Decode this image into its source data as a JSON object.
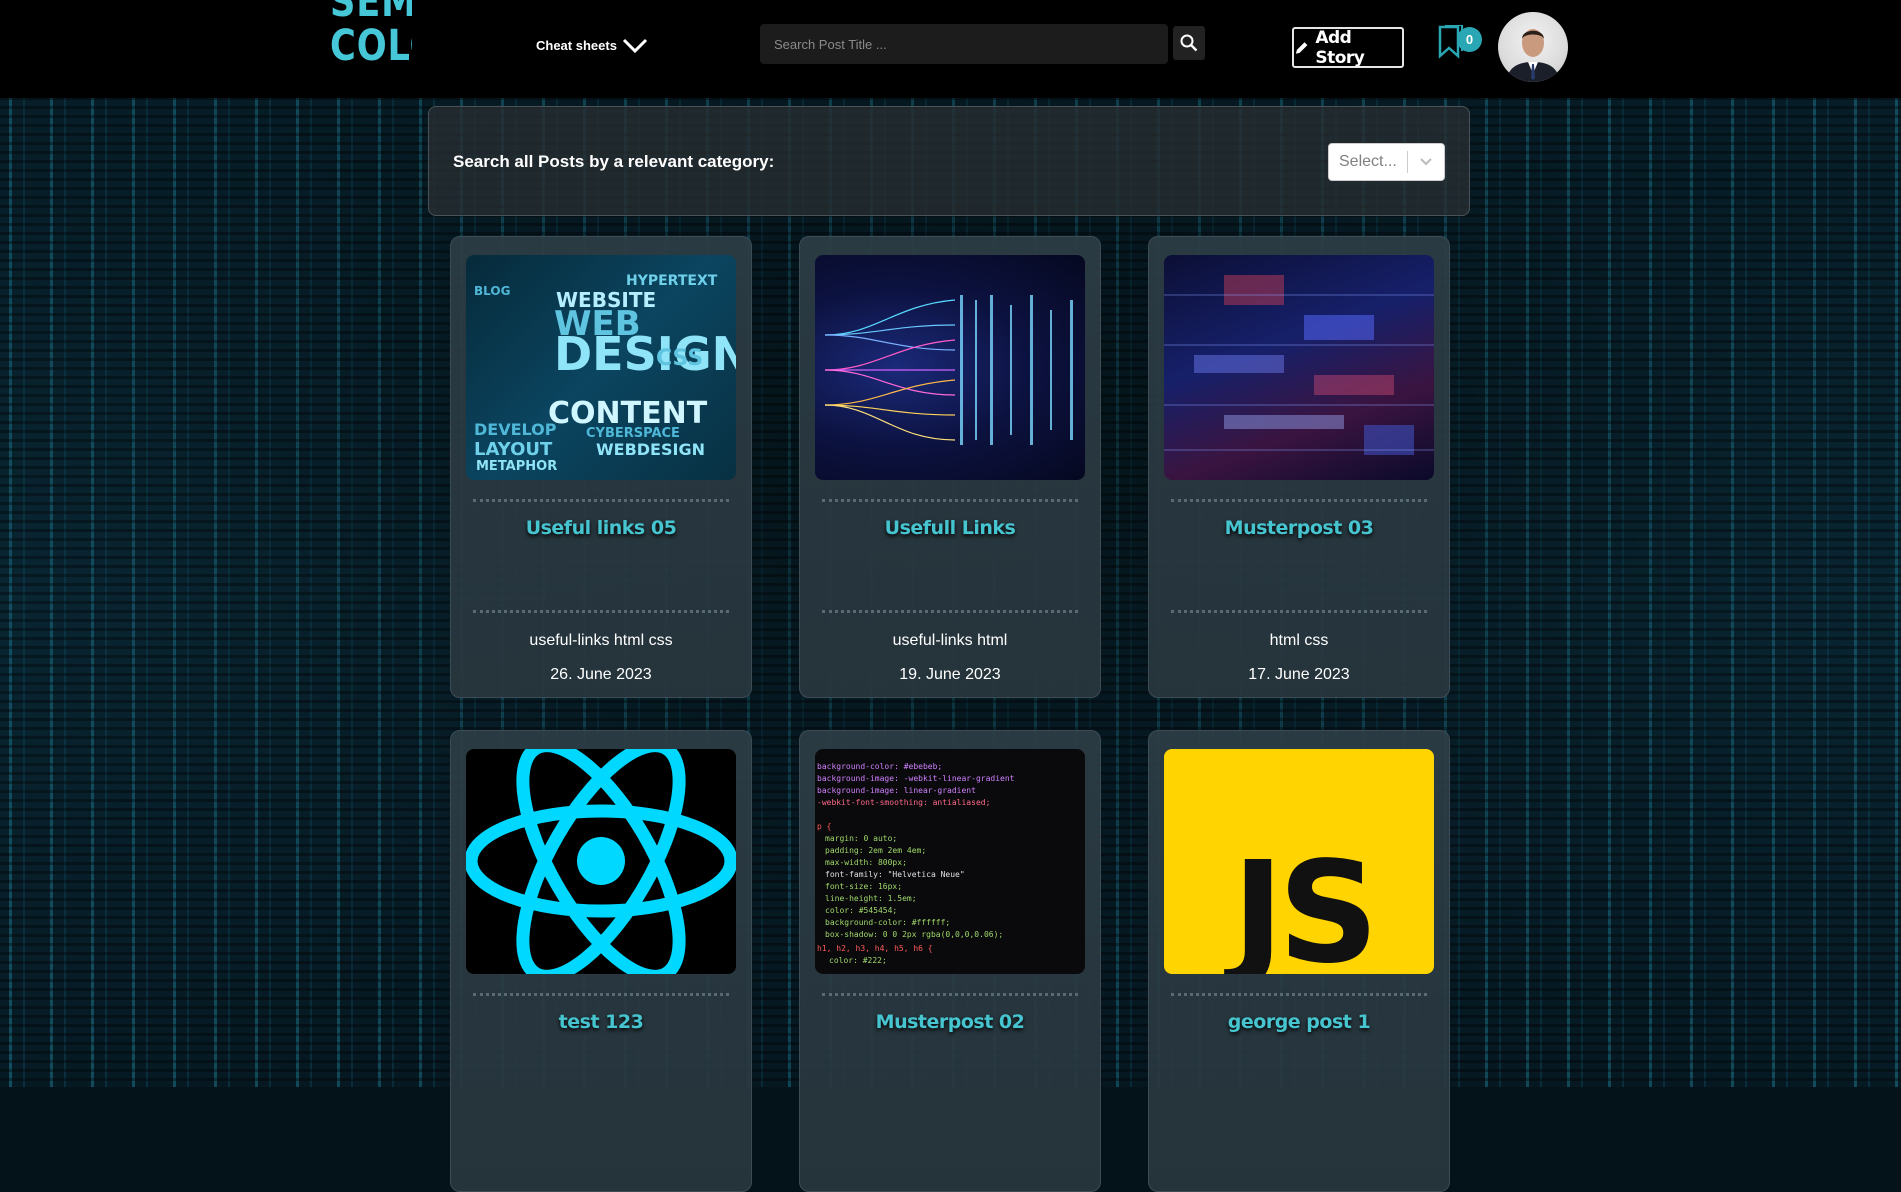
{
  "header": {
    "logo_line1": "SEMI",
    "logo_line2": "COLONS",
    "nav_cheat_sheets": "Cheat sheets",
    "search_placeholder": "Search Post Title ...",
    "add_story_label": "Add Story",
    "bookmark_count": "0"
  },
  "category": {
    "label": "Search all Posts by a relevant category:",
    "select_placeholder": "Select..."
  },
  "posts": [
    {
      "title": "Useful links 05",
      "tags": "useful-links html css",
      "date": "26. June 2023",
      "thumb": "web-design-word-cloud"
    },
    {
      "title": "Usefull Links",
      "tags": "useful-links html",
      "date": "19. June 2023",
      "thumb": "data-fibers"
    },
    {
      "title": "Musterpost 03",
      "tags": "html css",
      "date": "17. June 2023",
      "thumb": "digital-city"
    },
    {
      "title": "test 123",
      "tags": "",
      "date": "",
      "thumb": "react-logo"
    },
    {
      "title": "Musterpost 02",
      "tags": "",
      "date": "",
      "thumb": "css-code"
    },
    {
      "title": "george post 1",
      "tags": "",
      "date": "",
      "thumb": "js-logo"
    }
  ],
  "colors": {
    "accent": "#46c4d0",
    "header_bg": "#000000",
    "js_yellow": "#ffd400",
    "react_blue": "#00d8ff"
  }
}
